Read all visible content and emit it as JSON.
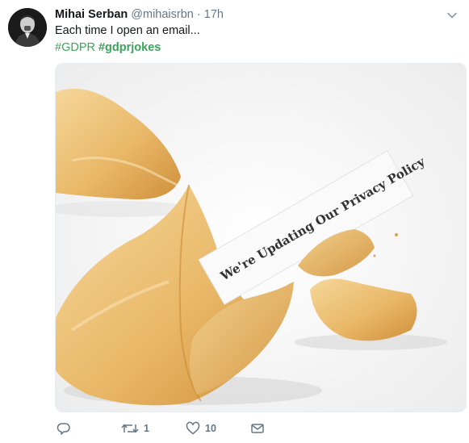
{
  "tweet": {
    "display_name": "Mihai Serban",
    "handle": "@mihaisrbn",
    "separator": "·",
    "timestamp": "17h",
    "text": "Each time I open an email...",
    "hashtags": [
      "#GDPR",
      "#gdprjokes"
    ],
    "image": {
      "slip_text": "We're Updating Our Privacy Policy",
      "icon": "fortune-cookie-photo"
    },
    "actions": {
      "reply_icon": "reply-icon",
      "retweet_icon": "retweet-icon",
      "retweet_count": "1",
      "like_icon": "heart-icon",
      "like_count": "10",
      "dm_icon": "envelope-icon"
    },
    "colors": {
      "hashtag": "#3ca45b",
      "secondary_text": "#657786",
      "primary_text": "#14171a"
    }
  }
}
